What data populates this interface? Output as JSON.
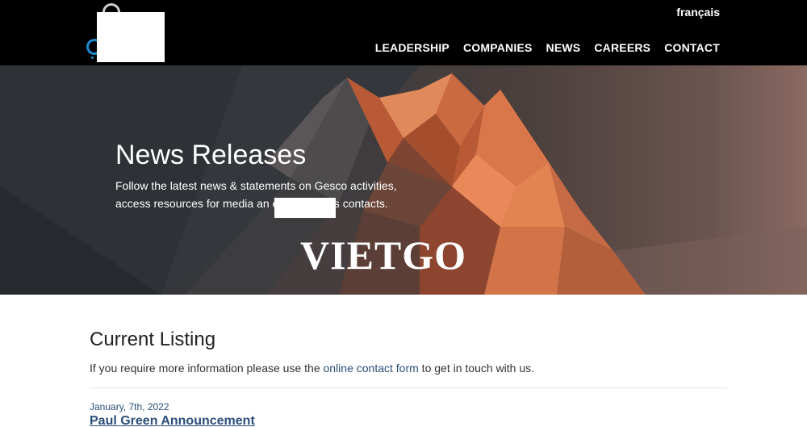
{
  "header": {
    "language_link": "français",
    "nav": {
      "leadership": "LEADERSHIP",
      "companies": "COMPANIES",
      "news": "NEWS",
      "careers": "CAREERS",
      "contact": "CONTACT"
    }
  },
  "hero": {
    "title": "News Releases",
    "description_1": "Follow the latest news & statements on Gesco activities, access resources for media an",
    "description_2": "edia relations contacts.",
    "watermark": "VIETGO"
  },
  "main": {
    "section_title": "Current Listing",
    "intro_before": "If you require more information please use the ",
    "intro_link": "online contact form",
    "intro_after": " to get in touch with us.",
    "listing": [
      {
        "date": "January, 7th, 2022",
        "title": "Paul Green Announcement"
      }
    ]
  },
  "colors": {
    "header_bg": "#000000",
    "link": "#2a4e7a",
    "mountain_orange": "#d9774a",
    "logo_blue": "#1b8bd0"
  }
}
